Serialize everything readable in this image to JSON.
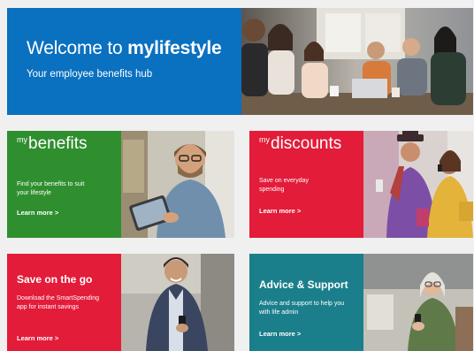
{
  "colors": {
    "hero_blue": "#0a70c0",
    "benefits_green": "#2f8f2f",
    "discounts_red": "#e31c39",
    "go_red": "#e31c39",
    "advice_teal": "#1a7f8b"
  },
  "hero": {
    "title_prefix": "Welcome to ",
    "title_brand": "mylifestyle",
    "subtitle": "Your employee benefits hub"
  },
  "cards": {
    "benefits": {
      "title_sup": "my",
      "title_main": "benefits",
      "description": "Find your benefits to suit your lifestyle",
      "link": "Learn more >"
    },
    "discounts": {
      "title_sup": "my",
      "title_main": "discounts",
      "description": "Save on everyday spending",
      "link": "Learn more >"
    },
    "save_on_go": {
      "title": "Save on the go",
      "description": "Download the SmartSpending app for instant savings",
      "link": "Learn more >"
    },
    "advice": {
      "title": "Advice & Support",
      "description": "Advice and support to help you with life admin",
      "link": "Learn more >"
    }
  }
}
